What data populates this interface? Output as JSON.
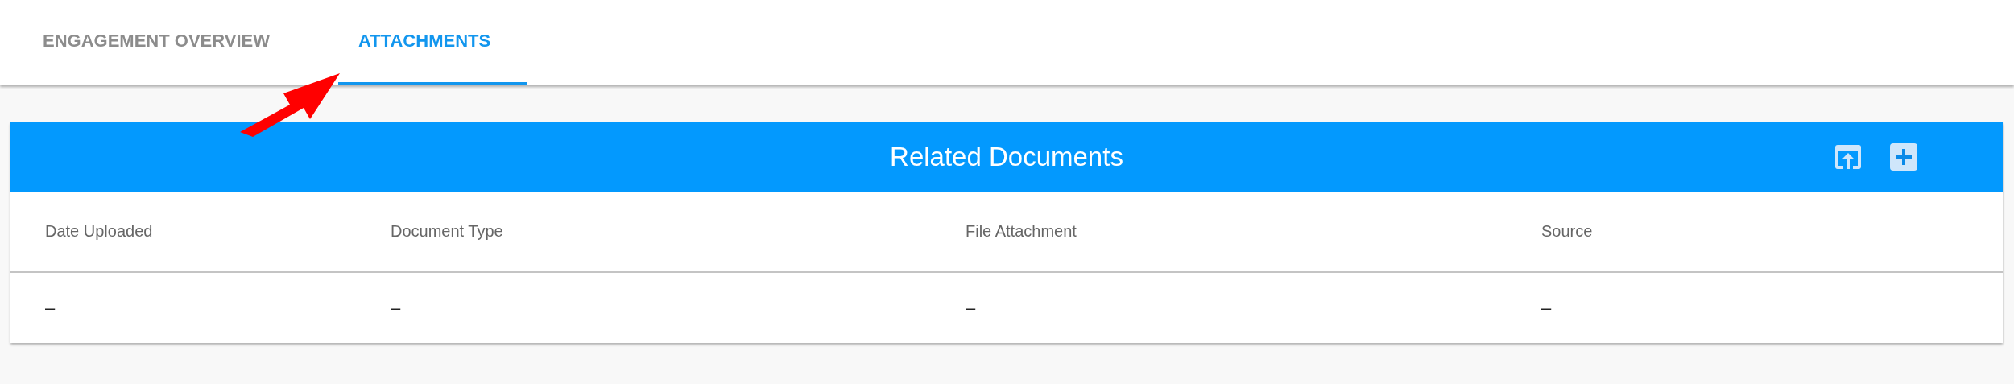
{
  "tabs": [
    {
      "label": "ENGAGEMENT OVERVIEW",
      "selected": false
    },
    {
      "label": "ATTACHMENTS",
      "selected": true
    }
  ],
  "panel": {
    "title": "Related Documents",
    "columns": [
      "Date Uploaded",
      "Document Type",
      "File Attachment",
      "Source"
    ],
    "rows": [
      [
        "–",
        "–",
        "–",
        "–"
      ]
    ]
  }
}
